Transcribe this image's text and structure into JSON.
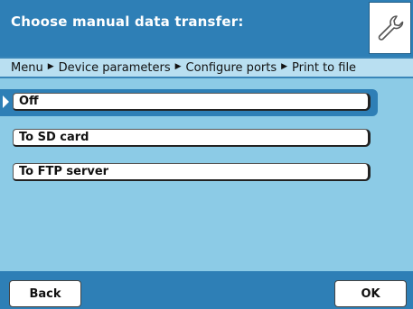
{
  "header": {
    "title": "Choose manual data transfer:",
    "icon": "wrench-icon"
  },
  "breadcrumb": {
    "items": [
      "Menu",
      "Device parameters",
      "Configure ports",
      "Print to file"
    ],
    "separator": "▶"
  },
  "options": [
    {
      "label": "Off",
      "selected": true
    },
    {
      "label": "To SD card",
      "selected": false
    },
    {
      "label": "To FTP server",
      "selected": false
    }
  ],
  "footer": {
    "back_label": "Back",
    "ok_label": "OK"
  },
  "colors": {
    "header": "#2e7fb6",
    "background": "#8ccbe6",
    "breadcrumb": "#b9dff1"
  }
}
